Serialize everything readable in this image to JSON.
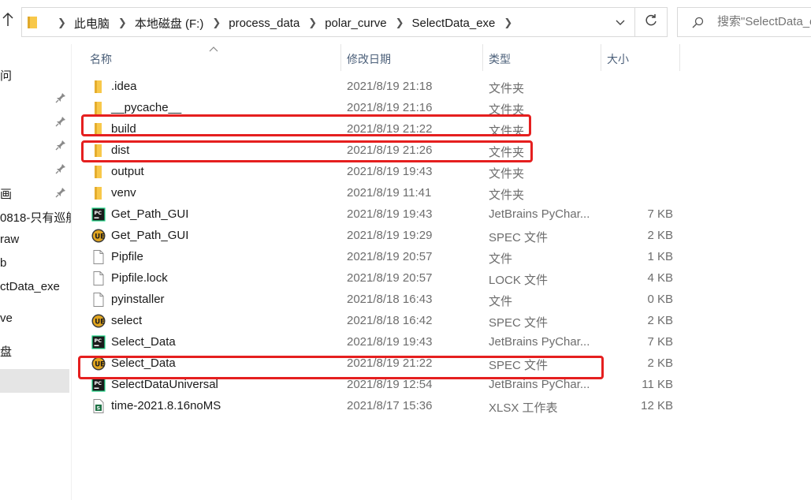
{
  "address_bar": {
    "breadcrumbs": [
      "此电脑",
      "本地磁盘 (F:)",
      "process_data",
      "polar_curve",
      "SelectData_exe"
    ]
  },
  "search": {
    "placeholder": "搜索\"SelectData_exe\""
  },
  "nav_pane": {
    "items": [
      {
        "label": "问",
        "pinned": false
      },
      {
        "label": "",
        "pinned": true
      },
      {
        "label": "",
        "pinned": true
      },
      {
        "label": "",
        "pinned": true
      },
      {
        "label": "",
        "pinned": true
      },
      {
        "label": "画",
        "pinned": true
      },
      {
        "label": "0818-只有巡航",
        "pinned": false
      },
      {
        "label": "raw",
        "pinned": false
      },
      {
        "label": "b",
        "pinned": false
      },
      {
        "label": "ctData_exe",
        "pinned": false
      },
      {
        "label": "ve",
        "pinned": false
      },
      {
        "label": "盘",
        "pinned": false
      }
    ]
  },
  "columns": {
    "name": "名称",
    "date": "修改日期",
    "type": "类型",
    "size": "大小"
  },
  "files": [
    {
      "name": ".idea",
      "date": "2021/8/19 21:18",
      "type": "文件夹",
      "size": "",
      "icon": "folder-icon"
    },
    {
      "name": "__pycache__",
      "date": "2021/8/19 21:16",
      "type": "文件夹",
      "size": "",
      "icon": "folder-icon"
    },
    {
      "name": "build",
      "date": "2021/8/19 21:22",
      "type": "文件夹",
      "size": "",
      "icon": "folder-icon"
    },
    {
      "name": "dist",
      "date": "2021/8/19 21:26",
      "type": "文件夹",
      "size": "",
      "icon": "folder-icon"
    },
    {
      "name": "output",
      "date": "2021/8/19 19:43",
      "type": "文件夹",
      "size": "",
      "icon": "folder-icon"
    },
    {
      "name": "venv",
      "date": "2021/8/19 11:41",
      "type": "文件夹",
      "size": "",
      "icon": "folder-icon"
    },
    {
      "name": "Get_Path_GUI",
      "date": "2021/8/19 19:43",
      "type": "JetBrains PyChar...",
      "size": "7 KB",
      "icon": "pycharm-icon"
    },
    {
      "name": "Get_Path_GUI",
      "date": "2021/8/19 19:29",
      "type": "SPEC 文件",
      "size": "2 KB",
      "icon": "ultraedit-icon"
    },
    {
      "name": "Pipfile",
      "date": "2021/8/19 20:57",
      "type": "文件",
      "size": "1 KB",
      "icon": "blank-file-icon"
    },
    {
      "name": "Pipfile.lock",
      "date": "2021/8/19 20:57",
      "type": "LOCK 文件",
      "size": "4 KB",
      "icon": "blank-file-icon"
    },
    {
      "name": "pyinstaller",
      "date": "2021/8/18 16:43",
      "type": "文件",
      "size": "0 KB",
      "icon": "blank-file-icon"
    },
    {
      "name": "select",
      "date": "2021/8/18 16:42",
      "type": "SPEC 文件",
      "size": "2 KB",
      "icon": "ultraedit-icon"
    },
    {
      "name": "Select_Data",
      "date": "2021/8/19 19:43",
      "type": "JetBrains PyChar...",
      "size": "7 KB",
      "icon": "pycharm-icon"
    },
    {
      "name": "Select_Data",
      "date": "2021/8/19 21:22",
      "type": "SPEC 文件",
      "size": "2 KB",
      "icon": "ultraedit-icon"
    },
    {
      "name": "SelectDataUniversal",
      "date": "2021/8/19 12:54",
      "type": "JetBrains PyChar...",
      "size": "11 KB",
      "icon": "pycharm-icon"
    },
    {
      "name": "time-2021.8.16noMS",
      "date": "2021/8/17 15:36",
      "type": "XLSX 工作表",
      "size": "12 KB",
      "icon": "xlsx-icon"
    }
  ],
  "colors": {
    "highlight": "#e51f1f",
    "folder": "#f8c84a",
    "header_text": "#4c607a"
  }
}
